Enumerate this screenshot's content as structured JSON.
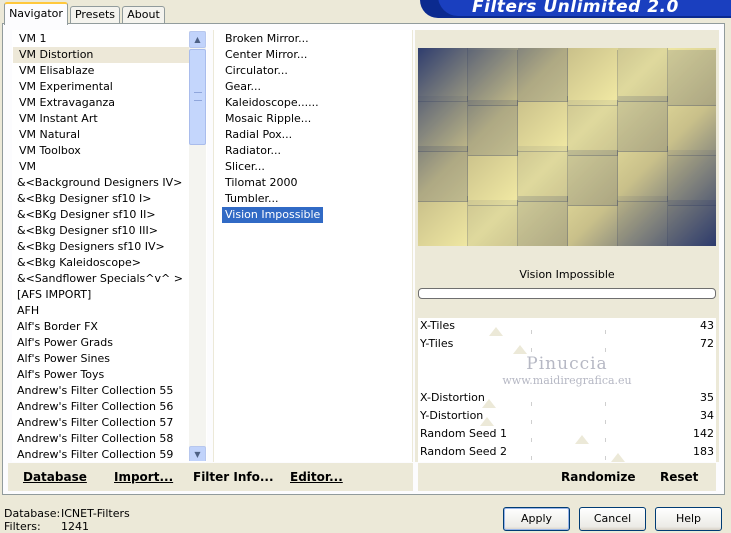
{
  "banner": {
    "title": "Filters Unlimited 2.0"
  },
  "tabs": [
    {
      "label": "Navigator",
      "active": true
    },
    {
      "label": "Presets",
      "active": false
    },
    {
      "label": "About",
      "active": false
    }
  ],
  "categories": {
    "selected": "VM Distortion",
    "items": [
      "VM 1",
      "VM Distortion",
      "VM Elisablaze",
      "VM Experimental",
      "VM Extravaganza",
      "VM Instant Art",
      "VM Natural",
      "VM Toolbox",
      "VM",
      "&<Background Designers IV>",
      "&<Bkg Designer sf10 I>",
      "&<BKg Designer sf10 II>",
      "&<Bkg Designer sf10 III>",
      "&<Bkg Designers sf10 IV>",
      "&<Bkg Kaleidoscope>",
      "&<Sandflower Specials^v^ >",
      "[AFS IMPORT]",
      "AFH",
      "Alf's Border FX",
      "Alf's Power Grads",
      "Alf's Power Sines",
      "Alf's Power Toys",
      "Andrew's Filter Collection 55",
      "Andrew's Filter Collection 56",
      "Andrew's Filter Collection 57",
      "Andrew's Filter Collection 58",
      "Andrew's Filter Collection 59"
    ]
  },
  "filters": {
    "selected": "Vision Impossible",
    "items": [
      "Broken Mirror...",
      "Center Mirror...",
      "Circulator...",
      "Gear...",
      "Kaleidoscope......",
      "Mosaic Ripple...",
      "Radial Pox...",
      "Radiator...",
      "Slicer...",
      "Tilomat 2000",
      "Tumbler...",
      "Vision Impossible"
    ]
  },
  "preview": {
    "filter_name": "Vision Impossible",
    "progress": 0
  },
  "sliders": [
    {
      "label": "X-Tiles",
      "value": "43",
      "fraction": 0.17
    },
    {
      "label": "Y-Tiles",
      "value": "72",
      "fraction": 0.28
    },
    {
      "label": "X-Distortion",
      "value": "35",
      "fraction": 0.14
    },
    {
      "label": "Y-Distortion",
      "value": "34",
      "fraction": 0.13
    },
    {
      "label": "Random Seed 1",
      "value": "142",
      "fraction": 0.56
    },
    {
      "label": "Random Seed 2",
      "value": "183",
      "fraction": 0.72
    }
  ],
  "watermark": {
    "title": "Pinuccia",
    "url": "www.maidiregrafica.eu"
  },
  "left_actions": {
    "database": "Database",
    "import": "Import...",
    "filter_info": "Filter Info...",
    "editor": "Editor..."
  },
  "right_actions": {
    "randomize": "Randomize",
    "reset": "Reset"
  },
  "status": {
    "database_label": "Database:",
    "database_value": "ICNET-Filters",
    "filters_label": "Filters:",
    "filters_value": "1241"
  },
  "dialog_buttons": {
    "apply": "Apply",
    "cancel": "Cancel",
    "help": "Help"
  },
  "colors": {
    "selection": "#316ac5",
    "tab_highlight": "#ffc83c",
    "banner": "#0b2a8f"
  }
}
